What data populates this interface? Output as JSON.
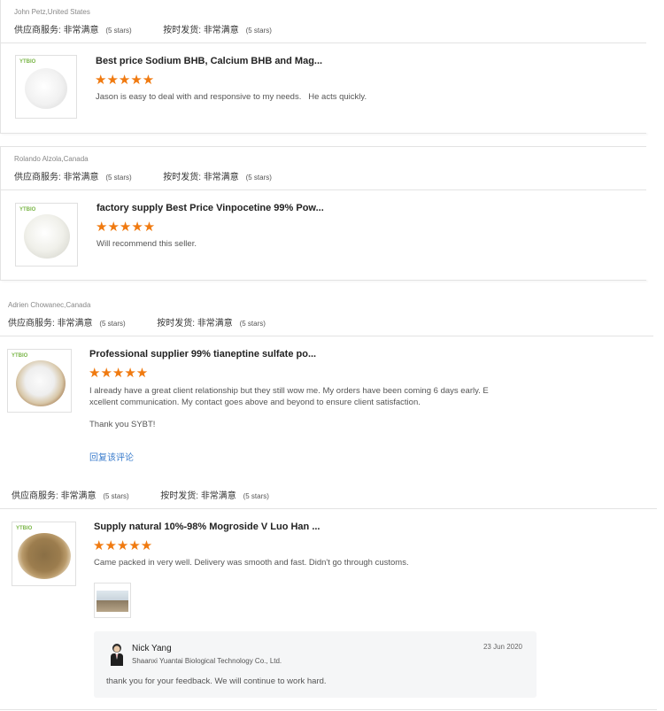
{
  "reviews": [
    {
      "reviewer": "John Petz,United States",
      "supplier_label": "供应商服务:",
      "supplier_value": "非常满意",
      "supplier_stars": "(5 stars)",
      "delivery_label": "按时发货:",
      "delivery_value": "非常满意",
      "delivery_stars": "(5 stars)",
      "brand": "YTBIO",
      "product_title": "Best price Sodium BHB, Calcium BHB and Mag...",
      "stars": "★★★★★",
      "rating": 5,
      "text": "Jason is easy to deal with and responsive to my needs.   He acts quickly."
    },
    {
      "reviewer": "Rolando Alzola,Canada",
      "supplier_label": "供应商服务:",
      "supplier_value": "非常满意",
      "supplier_stars": "(5 stars)",
      "delivery_label": "按时发货:",
      "delivery_value": "非常满意",
      "delivery_stars": "(5 stars)",
      "brand": "YTBIO",
      "product_title": "factory supply Best Price Vinpocetine 99% Pow...",
      "stars": "★★★★★",
      "rating": 5,
      "text": "Will recommend this seller."
    },
    {
      "reviewer": "Adrien Chowanec,Canada",
      "supplier_label": "供应商服务:",
      "supplier_value": "非常满意",
      "supplier_stars": "(5 stars)",
      "delivery_label": "按时发货:",
      "delivery_value": "非常满意",
      "delivery_stars": "(5 stars)",
      "brand": "YTBIO",
      "product_title": "Professional supplier 99% tianeptine sulfate po...",
      "stars": "★★★★★",
      "rating": 5,
      "text_line1": "I already have a great client relationship but they still wow me. My orders have been coming 6 days early. E",
      "text_line2": "xcellent communication. My contact goes above and beyond to ensure client satisfaction.",
      "text_line3": "Thank you SYBT!",
      "reply_link": "回复该评论"
    },
    {
      "supplier_label": "供应商服务:",
      "supplier_value": "非常满意",
      "supplier_stars": "(5 stars)",
      "delivery_label": "按时发货:",
      "delivery_value": "非常满意",
      "delivery_stars": "(5 stars)",
      "brand": "YTBIO",
      "product_title": "Supply natural 10%-98% Mogroside V Luo Han ...",
      "stars": "★★★★★",
      "rating": 5,
      "text": "Came packed in very well. Delivery was smooth and fast. Didn't go through customs.",
      "reply": {
        "name": "Nick Yang",
        "company": "Shaanxi Yuantai Biological Technology Co., Ltd.",
        "date": "23 Jun 2020",
        "text": "thank you for your feedback. We will continue to work hard."
      }
    }
  ]
}
